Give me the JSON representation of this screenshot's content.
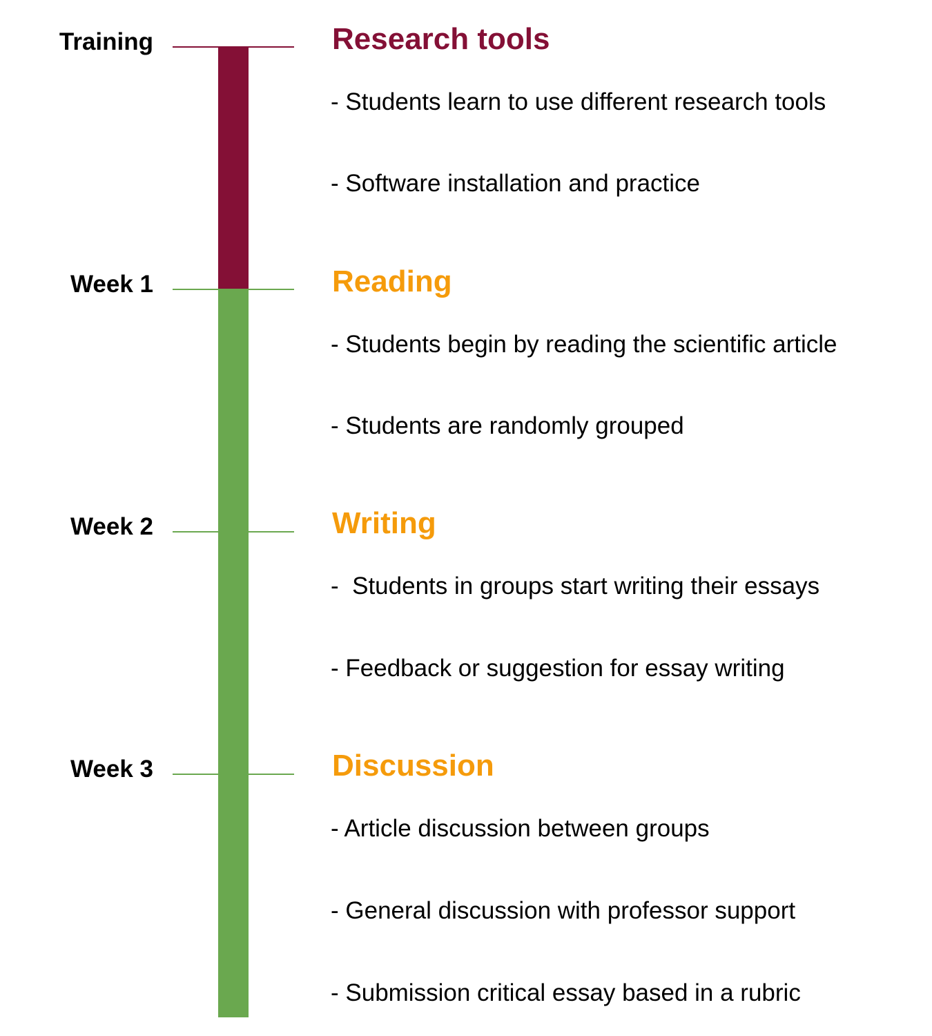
{
  "colors": {
    "training": "#841036",
    "weeks": "#6aa84f",
    "phase_research": "#841036",
    "phase_other": "#f59b0b"
  },
  "stages": [
    "Training",
    "Week 1",
    "Week 2",
    "Week 3"
  ],
  "phases": [
    {
      "title": "Research tools",
      "items": [
        "- Students learn to use different research tools",
        "- Software installation and practice"
      ]
    },
    {
      "title": "Reading",
      "items": [
        "- Students begin by reading the scientific article",
        "- Students are randomly grouped"
      ]
    },
    {
      "title": "Writing",
      "items": [
        "-  Students in groups start writing their essays",
        "- Feedback or suggestion for essay writing"
      ]
    },
    {
      "title": "Discussion",
      "items": [
        "- Article discussion between groups",
        "- General discussion with professor support",
        "- Submission critical essay based in a rubric"
      ]
    }
  ]
}
